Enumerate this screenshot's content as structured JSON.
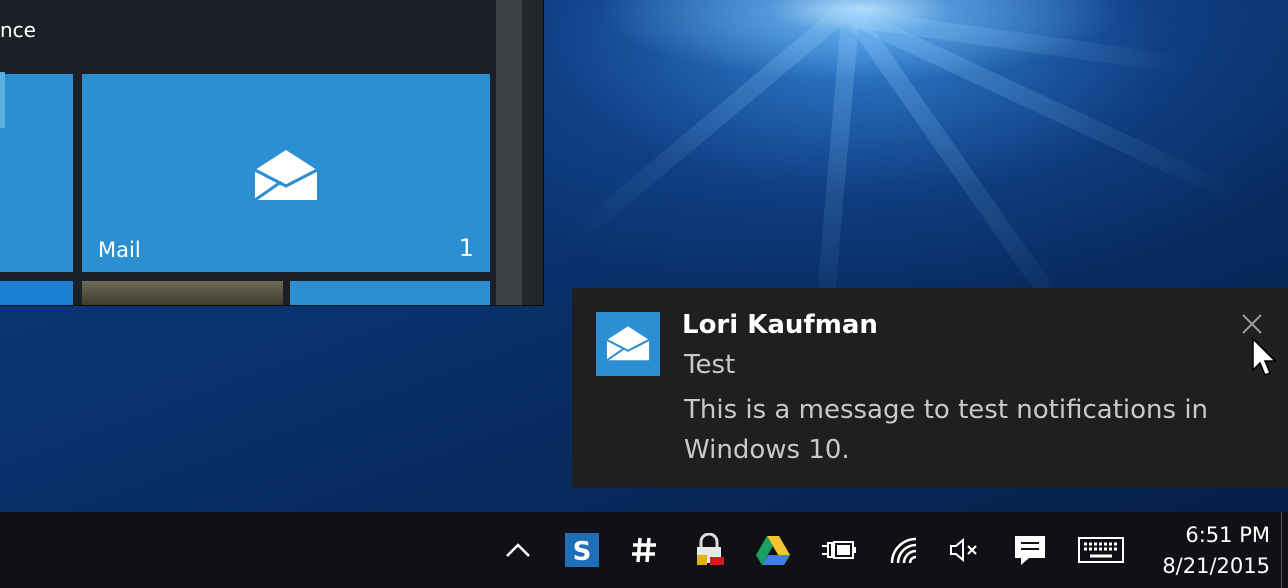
{
  "start_menu": {
    "header_fragment": "nce",
    "mail_tile": {
      "label": "Mail",
      "count": "1",
      "icon": "mail-icon"
    }
  },
  "notification": {
    "app_icon": "mail-icon",
    "sender": "Lori Kaufman",
    "subject": "Test",
    "body": "This is a message to test notifications in Windows 10.",
    "close_icon": "close-icon"
  },
  "taskbar": {
    "tray_icons": [
      "chevron-up-icon",
      "s-app-icon",
      "slack-hash-icon",
      "lock-key-icon",
      "google-drive-icon",
      "battery-charging-icon",
      "wifi-icon",
      "volume-muted-icon",
      "action-center-icon",
      "keyboard-icon"
    ],
    "time": "6:51 PM",
    "date": "8/21/2015"
  },
  "colors": {
    "accent": "#2b8fd1",
    "toast_bg": "#1f1f1f",
    "taskbar_bg": "#101114",
    "start_bg": "#1b1f26"
  }
}
